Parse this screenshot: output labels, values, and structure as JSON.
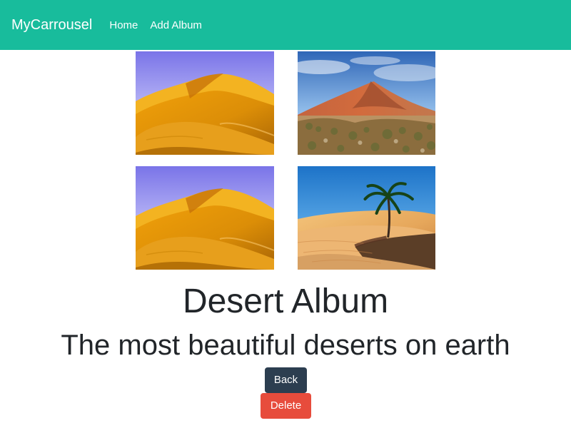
{
  "navbar": {
    "brand": "MyCarrousel",
    "links": [
      {
        "label": "Home"
      },
      {
        "label": "Add Album"
      }
    ],
    "color": "#18bc9c"
  },
  "gallery": {
    "photos": [
      {
        "name": "desert-dunes-photo"
      },
      {
        "name": "desert-shrubland-photo"
      },
      {
        "name": "desert-dunes-photo"
      },
      {
        "name": "desert-palm-photo"
      }
    ]
  },
  "album": {
    "title": "Desert Album",
    "description": "The most beautiful deserts on earth"
  },
  "actions": {
    "back_label": "Back",
    "delete_label": "Delete",
    "back_color": "#2c3e50",
    "delete_color": "#e74c3c"
  }
}
